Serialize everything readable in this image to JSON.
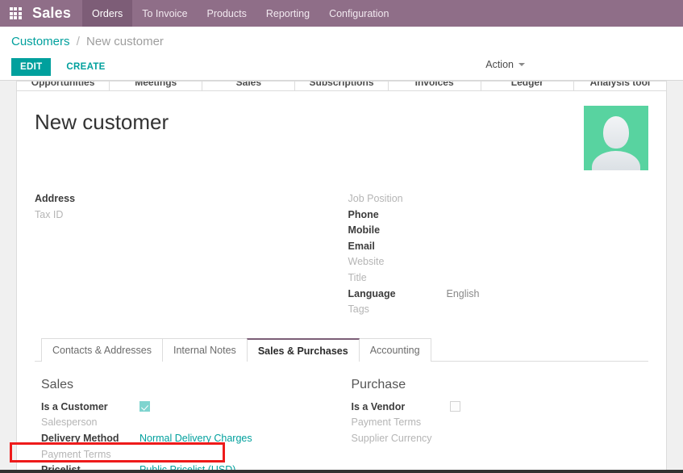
{
  "navbar": {
    "apps_icon": "apps-grid-icon",
    "brand": "Sales",
    "menu": [
      {
        "label": "Orders",
        "active": true
      },
      {
        "label": "To Invoice",
        "active": false
      },
      {
        "label": "Products",
        "active": false
      },
      {
        "label": "Reporting",
        "active": false
      },
      {
        "label": "Configuration",
        "active": false
      }
    ]
  },
  "control_panel": {
    "breadcrumb_root": "Customers",
    "breadcrumb_sep": "/",
    "breadcrumb_current": "New customer",
    "edit_label": "EDIT",
    "create_label": "CREATE",
    "action_label": "Action"
  },
  "stat_buttons": [
    "Opportunities",
    "Meetings",
    "Sales",
    "Subscriptions",
    "Invoices",
    "Ledger",
    "Analysis tool"
  ],
  "record": {
    "title": "New customer",
    "avatar_bg": "#58d3a0",
    "left_fields": [
      {
        "label": "Address",
        "state": "filled",
        "value": ""
      },
      {
        "label": "Tax ID",
        "state": "empty",
        "value": ""
      }
    ],
    "right_fields": [
      {
        "label": "Job Position",
        "state": "empty",
        "value": ""
      },
      {
        "label": "Phone",
        "state": "filled",
        "value": ""
      },
      {
        "label": "Mobile",
        "state": "filled",
        "value": ""
      },
      {
        "label": "Email",
        "state": "filled",
        "value": ""
      },
      {
        "label": "Website",
        "state": "empty",
        "value": ""
      },
      {
        "label": "Title",
        "state": "empty",
        "value": ""
      },
      {
        "label": "Language",
        "state": "filled",
        "value": "English"
      },
      {
        "label": "Tags",
        "state": "empty",
        "value": ""
      }
    ]
  },
  "notebook": {
    "tabs": [
      {
        "label": "Contacts & Addresses",
        "active": false
      },
      {
        "label": "Internal Notes",
        "active": false
      },
      {
        "label": "Sales & Purchases",
        "active": true
      },
      {
        "label": "Accounting",
        "active": false
      }
    ],
    "sales": {
      "heading": "Sales",
      "rows": [
        {
          "label": "Is a Customer",
          "state": "filled",
          "kind": "checkbox",
          "checked": true,
          "value": ""
        },
        {
          "label": "Salesperson",
          "state": "empty",
          "kind": "text",
          "value": ""
        },
        {
          "label": "Delivery Method",
          "state": "filled",
          "kind": "link",
          "value": "Normal Delivery Charges"
        },
        {
          "label": "Payment Terms",
          "state": "empty",
          "kind": "text",
          "value": ""
        },
        {
          "label": "Pricelist",
          "state": "filled",
          "kind": "link",
          "value": "Public Pricelist (USD)"
        }
      ]
    },
    "purchase": {
      "heading": "Purchase",
      "rows": [
        {
          "label": "Is a Vendor",
          "state": "filled",
          "kind": "checkbox",
          "checked": false,
          "value": ""
        },
        {
          "label": "Payment Terms",
          "state": "empty",
          "kind": "text",
          "value": ""
        },
        {
          "label": "Supplier Currency",
          "state": "empty",
          "kind": "text",
          "value": ""
        }
      ]
    }
  },
  "annotation": {
    "color": "#ee1b1b",
    "target": "Pricelist"
  },
  "colors": {
    "navbar_bg": "#8f6e88",
    "navbar_active_bg": "#7d5d77",
    "accent_teal": "#00a09d",
    "tab_active_border": "#7c5e77",
    "checkbox_teal": "#7fd4cf"
  }
}
